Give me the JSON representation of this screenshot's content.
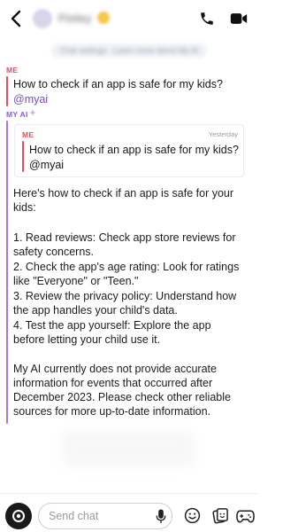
{
  "header": {
    "contact_name": "Finley",
    "back_icon": "chevron-left-icon",
    "call_icon": "phone-icon",
    "video_icon": "video-camera-icon"
  },
  "notice": {
    "text": "Chat settings · Learn more about My AI"
  },
  "messages": {
    "user_message": {
      "sender": "ME",
      "text": "How to check if an app is safe for my kids?",
      "mention": "@myai"
    },
    "ai_reply": {
      "sender": "MY AI",
      "sparkle_icon": "sparkle-icon",
      "quote": {
        "sender": "ME",
        "time": "Yesterday",
        "text": "How to check if an app is safe for my kids?",
        "mention": "@myai"
      },
      "intro_line1": "Here's how to check if an app is safe for your",
      "intro_line2": "kids:",
      "steps": [
        {
          "line1": "1.  Read reviews: Check app store reviews for",
          "line2": "safety concerns."
        },
        {
          "line1": "2.  Check the app's age rating: Look for ratings",
          "line2": "like \"Everyone\" or \"Teen.\""
        },
        {
          "line1": "3.  Review the privacy policy: Understand how",
          "line2": "the app handles your child's data."
        },
        {
          "line1": "4.  Test the app yourself: Explore the app",
          "line2": "before letting your child use it."
        }
      ],
      "disclaimer_lines": [
        "My AI currently does not provide accurate",
        "information for events that occurred after",
        "December 2023. Please check other reliable",
        "sources for more up-to-date information."
      ]
    }
  },
  "composer": {
    "placeholder": "Send chat",
    "camera_icon": "camera-icon",
    "mic_icon": "microphone-icon",
    "emoji_icon": "smiley-icon",
    "sticker_icon": "sticker-icon",
    "game_icon": "game-controller-icon"
  },
  "colors": {
    "me": "#e84a5f",
    "ai": "#8a5cd6",
    "mention": "#7b4bc9"
  }
}
